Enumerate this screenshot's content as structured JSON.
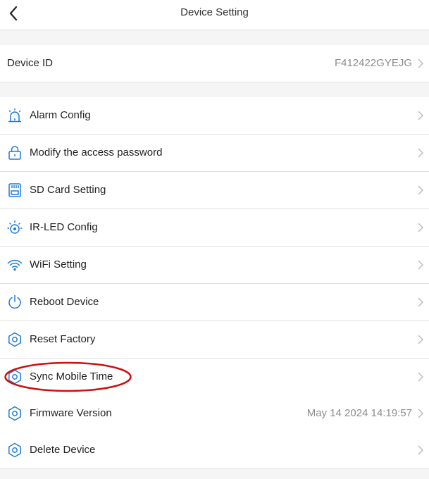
{
  "header": {
    "title": "Device Setting"
  },
  "device": {
    "label": "Device ID",
    "value": "F412422GYEJG"
  },
  "items": [
    {
      "label": "Alarm Config",
      "value": "",
      "icon": "alarm-light-icon"
    },
    {
      "label": "Modify the access password",
      "value": "",
      "icon": "lock-icon"
    },
    {
      "label": "SD Card Setting",
      "value": "",
      "icon": "sd-card-icon"
    },
    {
      "label": "IR-LED Config",
      "value": "",
      "icon": "ir-led-icon"
    },
    {
      "label": "WiFi Setting",
      "value": "",
      "icon": "wifi-icon"
    },
    {
      "label": "Reboot Device",
      "value": "",
      "icon": "power-icon"
    },
    {
      "label": "Reset Factory",
      "value": "",
      "icon": "gear-icon"
    },
    {
      "label": "Sync Mobile Time",
      "value": "",
      "icon": "gear-icon"
    },
    {
      "label": "Firmware Version",
      "value": "May 14 2024 14:19:57",
      "icon": "gear-icon"
    },
    {
      "label": "Delete Device",
      "value": "",
      "icon": "gear-icon"
    }
  ],
  "colors": {
    "accent": "#1f7bd8",
    "annotation": "#cc1010",
    "divider": "#e0e0e0",
    "section_gap": "#f5f5f5"
  }
}
